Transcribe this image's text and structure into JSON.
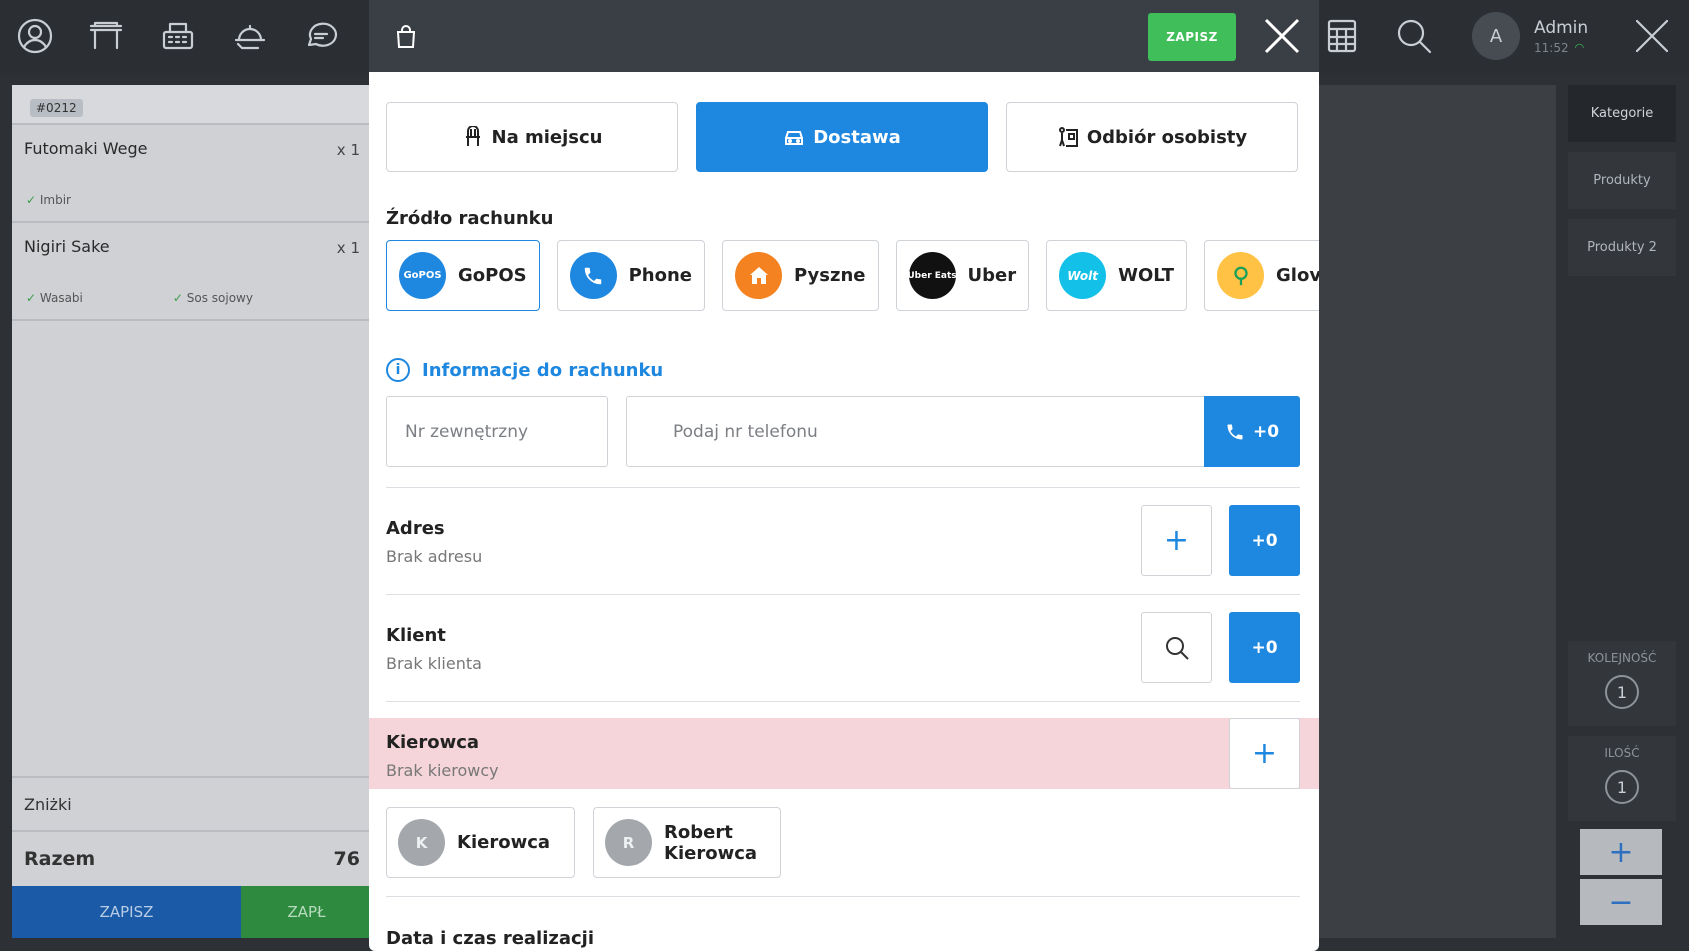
{
  "topbar": {
    "icons": [
      "account-icon",
      "table-icon",
      "cash-register-icon",
      "waiter-tray-icon",
      "chat-icon",
      "calculator-icon",
      "search-icon",
      "close-icon"
    ],
    "user": {
      "avatar_letter": "A",
      "name": "Admin",
      "time": "11:52"
    }
  },
  "order": {
    "number": "#0212",
    "items": [
      {
        "name": "Futomaki Wege",
        "qty": "x 1",
        "mods": [
          "Imbir"
        ]
      },
      {
        "name": "Nigiri Sake",
        "qty": "x 1",
        "mods": [
          "Wasabi",
          "Sos sojowy"
        ]
      }
    ],
    "discount_label": "Zniżki",
    "total_label": "Razem",
    "total_value": "76",
    "save_label": "ZAPISZ",
    "pay_label": "ZAPŁ"
  },
  "sidebar": {
    "items": [
      {
        "label": "Kategorie",
        "active": true
      },
      {
        "label": "Produkty",
        "active": false
      },
      {
        "label": "Produkty 2",
        "active": false
      }
    ],
    "order_label": "KOLEJNOŚĆ",
    "order_value": "1",
    "qty_label": "ILOŚĆ",
    "qty_value": "1",
    "plus": "+",
    "minus": "−"
  },
  "modal": {
    "save_label": "ZAPISZ",
    "types": [
      {
        "label": "Na miejscu",
        "icon": "seat-icon",
        "active": false
      },
      {
        "label": "Dostawa",
        "icon": "car-icon",
        "active": true
      },
      {
        "label": "Odbiór osobisty",
        "icon": "pickup-icon",
        "active": false
      }
    ],
    "source_title": "Źródło rachunku",
    "sources": [
      {
        "label": "GoPOS",
        "logo_text": "GoPOS",
        "color": "#1e87e0",
        "active": true
      },
      {
        "label": "Phone",
        "logo_text": "",
        "color": "#1e87e0",
        "active": false
      },
      {
        "label": "Pyszne",
        "logo_text": "",
        "color": "#f58220",
        "active": false
      },
      {
        "label": "Uber",
        "logo_text": "Uber Eats",
        "color": "#111111",
        "active": false
      },
      {
        "label": "WOLT",
        "logo_text": "Wolt",
        "color": "#12c0e8",
        "active": false
      },
      {
        "label": "Glovo",
        "logo_text": "",
        "color": "#ffc244",
        "active": false
      }
    ],
    "info_title": "Informacje do rachunku",
    "external_no_placeholder": "Nr zewnętrzny",
    "phone_placeholder": "Podaj nr telefonu",
    "phone_prefix": "+0",
    "address": {
      "label": "Adres",
      "sub": "Brak adresu",
      "count": "+0"
    },
    "client": {
      "label": "Klient",
      "sub": "Brak klienta",
      "count": "+0"
    },
    "driver": {
      "label": "Kierowca",
      "sub": "Brak kierowcy"
    },
    "drivers": [
      {
        "initial": "K",
        "name": "Kierowca"
      },
      {
        "initial": "R",
        "name": "Robert Kierowca"
      }
    ],
    "datetime_title": "Data i czas realizacji",
    "colors": {
      "accent": "#1e87e0",
      "save": "#3fbe5a",
      "driver_warning": "#f5d5da"
    }
  }
}
